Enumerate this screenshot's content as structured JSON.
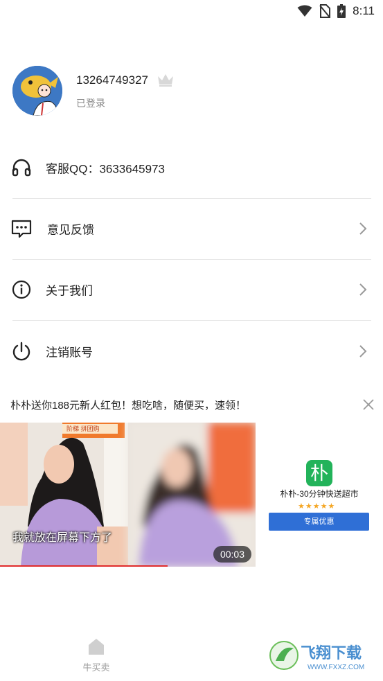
{
  "status": {
    "time": "8:11"
  },
  "profile": {
    "phone": "13264749327",
    "login_status": "已登录"
  },
  "menu": {
    "service_qq": "客服QQ：3633645973",
    "feedback": "意见反馈",
    "about": "关于我们",
    "logout": "注销账号"
  },
  "ad": {
    "title": "朴朴送你188元新人红包！想吃啥，随便买，速领！",
    "video_subtitle": "我就放在屏幕下方了",
    "video_badge": "阶梯 拼团购",
    "duration": "00:03",
    "app_icon_char": "朴",
    "app_name": "朴朴-30分钟快送超市",
    "rating": 5,
    "cta": "专属优惠"
  },
  "tabbar": {
    "home_label": "牛买卖"
  },
  "watermark": {
    "brand": "飞翔下载",
    "url": "WWW.FXXZ.COM"
  },
  "colors": {
    "accent_blue": "#2f6fd6",
    "app_green": "#22b35a",
    "progress_red": "#e02b2b"
  }
}
